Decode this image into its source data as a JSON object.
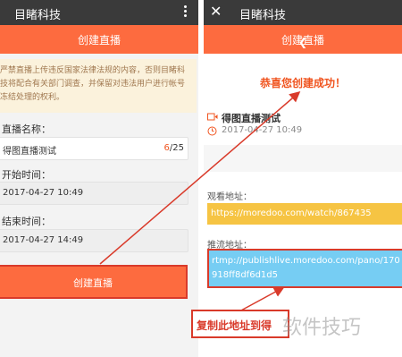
{
  "left": {
    "status_app_name": "目睹科技",
    "title": "创建直播",
    "notice_text": "严禁直播上传违反国家法律法规的内容，否则目睹科技将配合有关部门调查，并保留对违法用户进行帐号冻结处理的权利。",
    "name_label": "直播名称：",
    "name_value": "得图直播测试",
    "name_count_current": "6",
    "name_count_max": "/25",
    "start_label": "开始时间：",
    "start_value": "2017-04-27 10:49",
    "end_label": "结束时间：",
    "end_value": "2017-04-27 14:49",
    "create_button": "创建直播"
  },
  "right": {
    "status_app_name": "目睹科技",
    "title": "创建直播",
    "success_text": "恭喜您创建成功！",
    "live_title": "得图直播测试",
    "live_time": "2017-04-27 10:49",
    "watch_label": "观看地址：",
    "watch_url": "https://moredoo.com/watch/867435",
    "push_label": "推流地址：",
    "push_url": "rtmp://publishlive.moredoo.com/pano/170918ff8df6d1d5"
  },
  "annotation": {
    "tooltip_text": "复制此地址到得",
    "watermark_text": "软件技巧"
  },
  "colors": {
    "brand_orange": "#fd6b3f",
    "highlight_red": "#d93a2a",
    "watch_yellow": "#f6c443",
    "push_blue": "#76cdf3"
  },
  "icons": {
    "more": "more-vertical-icon",
    "close": "close-icon",
    "back": "back-arrow-icon",
    "video": "video-camera-icon",
    "clock": "clock-icon"
  }
}
